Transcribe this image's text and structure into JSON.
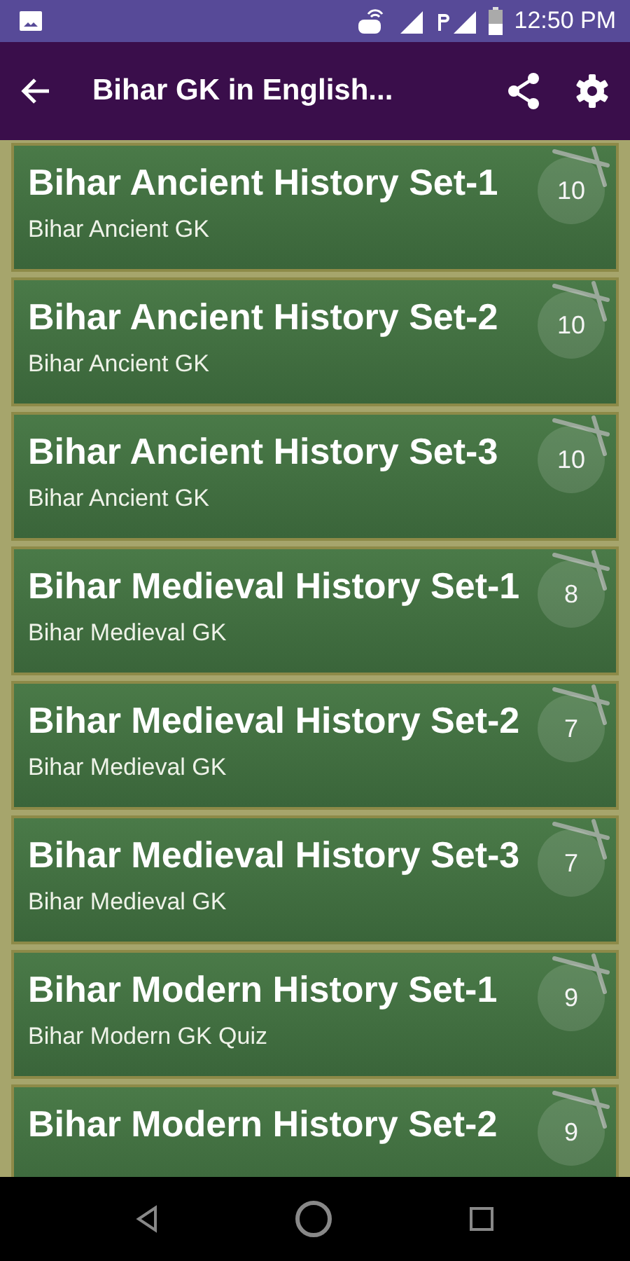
{
  "status_bar": {
    "time": "12:50 PM"
  },
  "app_bar": {
    "title": "Bihar GK in English..."
  },
  "sets": [
    {
      "title": "Bihar Ancient History Set-1",
      "subtitle": "Bihar Ancient GK",
      "count": "10"
    },
    {
      "title": "Bihar Ancient History Set-2",
      "subtitle": "Bihar Ancient GK",
      "count": "10"
    },
    {
      "title": "Bihar Ancient History Set-3",
      "subtitle": "Bihar Ancient GK",
      "count": "10"
    },
    {
      "title": "Bihar Medieval History Set-1",
      "subtitle": "Bihar Medieval GK",
      "count": "8"
    },
    {
      "title": "Bihar Medieval History Set-2",
      "subtitle": "Bihar Medieval GK",
      "count": "7"
    },
    {
      "title": "Bihar Medieval History Set-3",
      "subtitle": "Bihar Medieval GK",
      "count": "7"
    },
    {
      "title": "Bihar Modern History Set-1",
      "subtitle": "Bihar Modern GK Quiz",
      "count": "9"
    },
    {
      "title": "Bihar Modern History Set-2",
      "count": "9"
    }
  ]
}
